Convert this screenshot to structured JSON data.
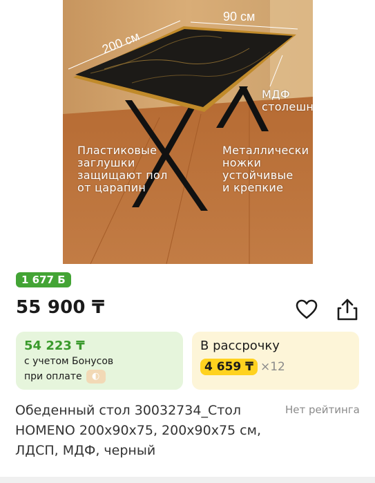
{
  "hero": {
    "dim_width": "200 см",
    "dim_depth": "90 см",
    "label_mdf": "МДФ\nстолешн",
    "label_plugs": "Пластиковые\nзаглушки\nзащищают пол\nот царапин",
    "label_legs": "Металлически\nножки\nустойчивые\nи крепкие"
  },
  "bonus_badge": "1 677 Б",
  "price": "55 900 ₸",
  "icons": {
    "favorite": "heart-icon",
    "share": "share-icon"
  },
  "bonus_card": {
    "amount": "54 223 ₸",
    "line1": "с учетом Бонусов",
    "line2": "при оплате"
  },
  "installment_card": {
    "title": "В рассрочку",
    "amount": "4 659 ₸",
    "multiplier": "×12"
  },
  "product_title": "Обеденный стол 30032734_Стол HOMENO 200x90x75, 200x90x75 см, ЛДСП, МДФ, черный",
  "rating_text": "Нет рейтинга",
  "colors": {
    "accent_green": "#43a435",
    "installment_yellow": "#ffd21f"
  }
}
